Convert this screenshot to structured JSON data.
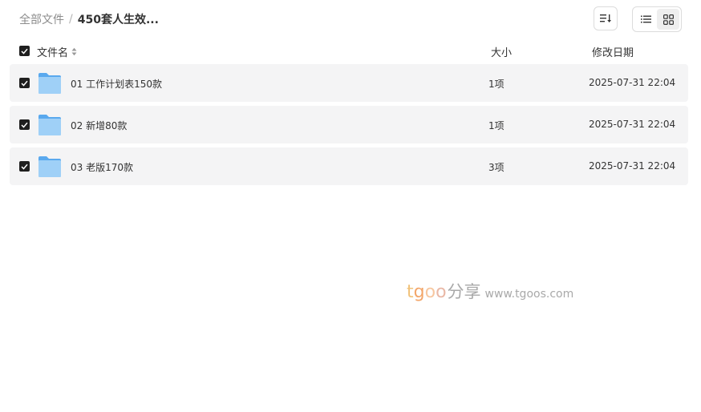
{
  "breadcrumb": {
    "root": "全部文件",
    "separator": "/",
    "current": "450套人生效..."
  },
  "toolbar": {
    "sort_icon": "sort-icon",
    "list_icon": "list-view-icon",
    "grid_icon": "grid-view-icon"
  },
  "table": {
    "headers": {
      "name": "文件名",
      "size": "大小",
      "date": "修改日期"
    },
    "rows": [
      {
        "name": "01 工作计划表150款",
        "size": "1项",
        "date": "2025-07-31 22:04",
        "checked": true
      },
      {
        "name": "02 新增80款",
        "size": "1项",
        "date": "2025-07-31 22:04",
        "checked": true
      },
      {
        "name": "03 老版170款",
        "size": "3项",
        "date": "2025-07-31 22:04",
        "checked": true
      }
    ]
  },
  "watermark": {
    "t": "t",
    "g": "g",
    "o1": "o",
    "o2": "o",
    "cn": "分享",
    "url": "www.tgoos.com"
  },
  "colors": {
    "row_bg": "#f4f4f5",
    "checkbox": "#1f1f1f",
    "folder_light": "#9fd0f7",
    "folder_dark": "#5aa9ee"
  }
}
